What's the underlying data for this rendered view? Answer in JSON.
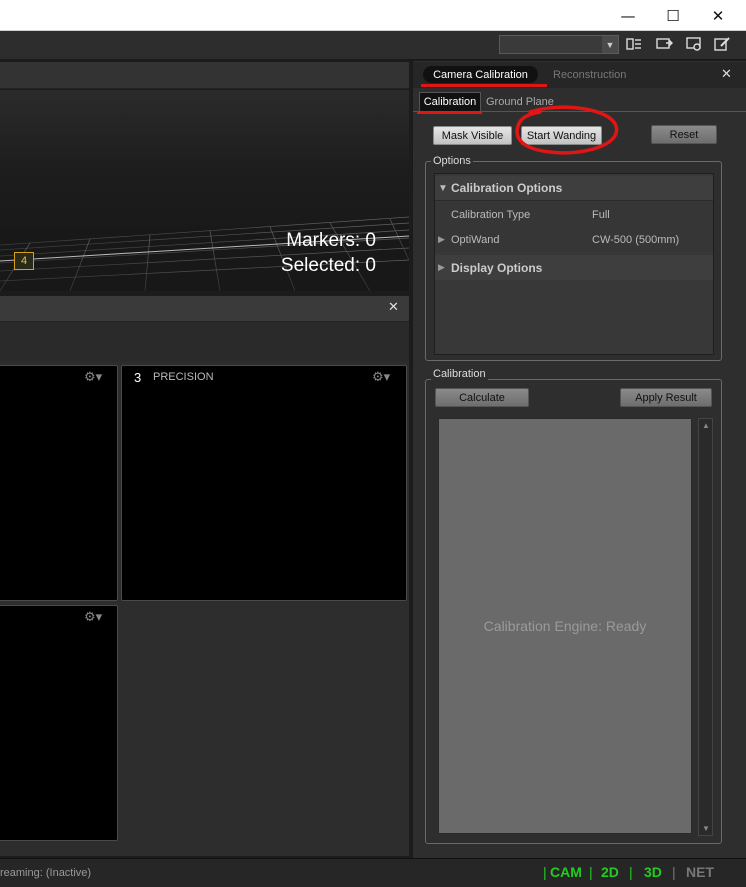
{
  "window": {
    "minimize_glyph": "—",
    "maximize_glyph": "☐",
    "close_glyph": "✕"
  },
  "toolbar": {
    "layout_value": "",
    "icons": [
      "layout-icon",
      "camera-view-icon",
      "camera-settings-icon",
      "edit-icon"
    ]
  },
  "viewport": {
    "markers_label": "Markers: 0",
    "selected_label": "Selected: 0",
    "camera_glyph": "4"
  },
  "cameras_pane": {
    "close_glyph": "✕",
    "views": [
      {
        "number": "",
        "label": ""
      },
      {
        "number": "3",
        "label": "PRECISION"
      },
      {
        "number": "",
        "label": ""
      }
    ],
    "gear_glyph": "⚙▾"
  },
  "right_panel": {
    "close_glyph": "✕",
    "tabs": [
      "Camera Calibration",
      "Reconstruction"
    ],
    "subtabs": [
      "Calibration",
      "Ground Plane"
    ],
    "buttons": {
      "mask_visible": "Mask Visible",
      "start_wanding": "Start Wanding",
      "reset": "Reset"
    },
    "options_legend": "Options",
    "calibration_options_header": "Calibration Options",
    "rows": [
      {
        "label": "Calibration Type",
        "value": "Full"
      },
      {
        "label": "OptiWand",
        "value": "CW-500 (500mm)"
      }
    ],
    "display_options_header": "Display Options",
    "calibration_legend": "Calibration",
    "calculate_button": "Calculate",
    "apply_button": "Apply Result",
    "engine_status": "Calibration Engine: Ready"
  },
  "status_bar": {
    "streaming": "reaming: (Inactive)",
    "cam": "CAM",
    "two_d": "2D",
    "three_d": "3D",
    "net": "NET",
    "separator": "|"
  },
  "colors": {
    "annotation_red": "#e01515",
    "status_green": "#22cc22",
    "status_inactive": "#777777"
  }
}
